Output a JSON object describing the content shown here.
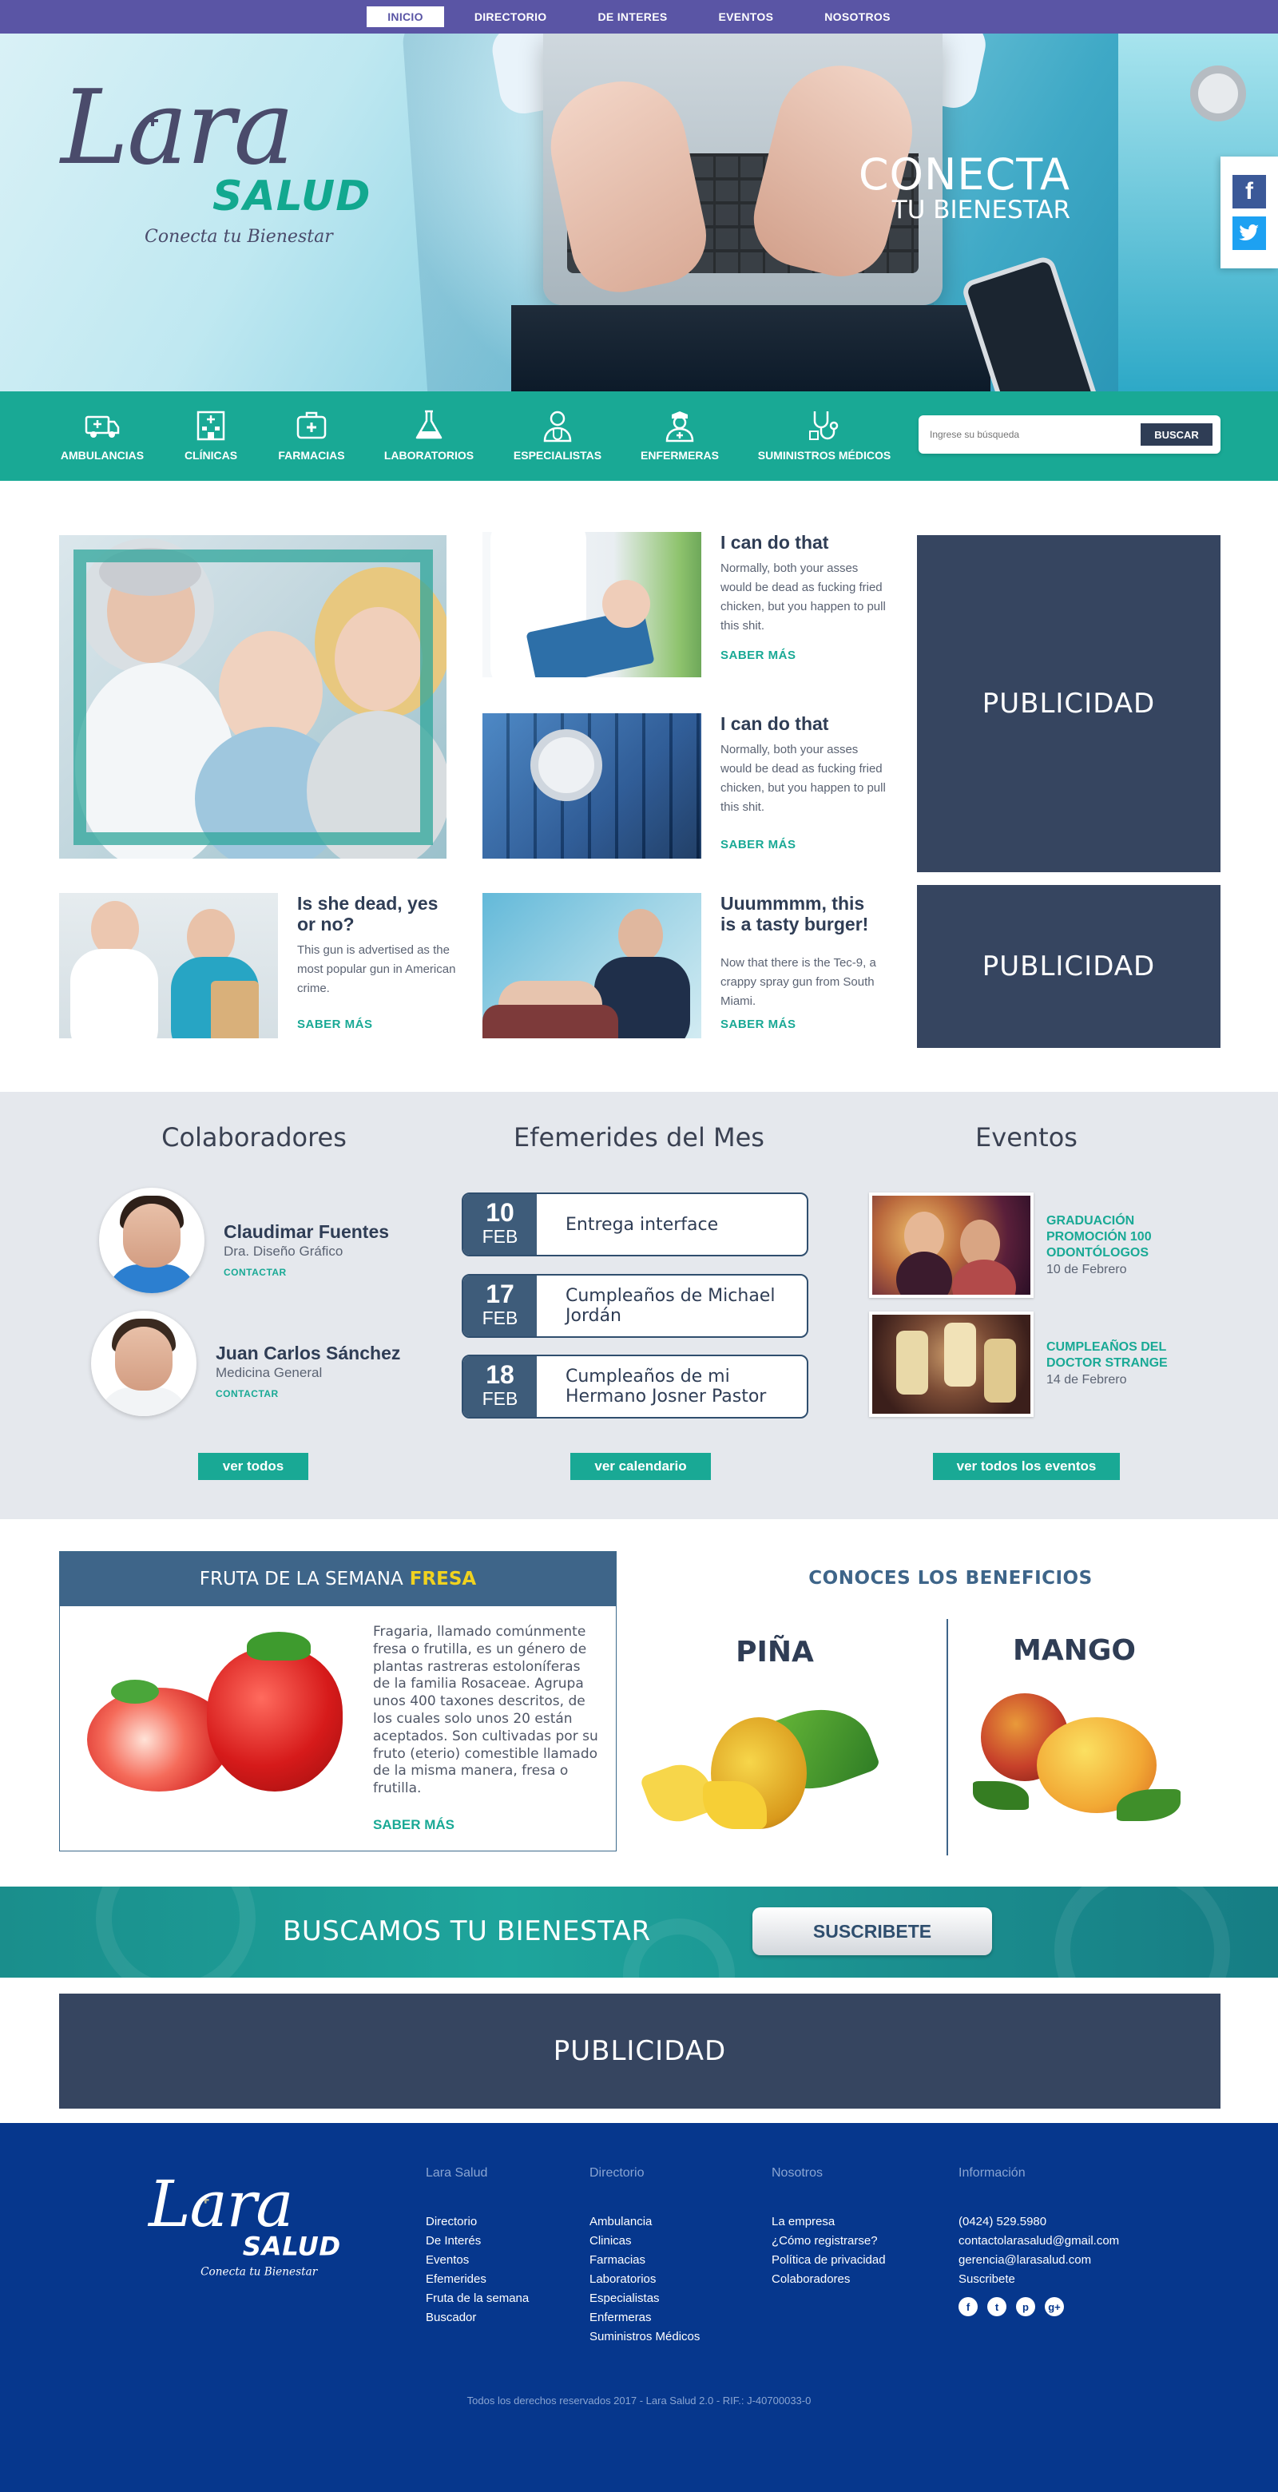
{
  "topnav": {
    "items": [
      "INICIO",
      "DIRECTORIO",
      "DE INTERES",
      "EVENTOS",
      "NOSOTROS"
    ],
    "active": "INICIO"
  },
  "hero": {
    "logo_word": "Lara",
    "logo_salud": "SALUD",
    "logo_tagline": "Conecta tu Bienestar",
    "headline": "CONECTA",
    "subline": "TU BIENESTAR",
    "social": [
      "f",
      "twitter"
    ]
  },
  "categories": {
    "items": [
      {
        "label": "AMBULANCIAS",
        "icon": "ambulance-icon"
      },
      {
        "label": "CLÍNICAS",
        "icon": "clinic-icon"
      },
      {
        "label": "FARMACIAS",
        "icon": "pharmacy-icon"
      },
      {
        "label": "LABORATORIOS",
        "icon": "lab-flask-icon"
      },
      {
        "label": "ESPECIALISTAS",
        "icon": "doctor-icon"
      },
      {
        "label": "ENFERMERAS",
        "icon": "nurse-icon"
      },
      {
        "label": "SUMINISTROS MÉDICOS",
        "icon": "stethoscope-icon"
      }
    ],
    "search_placeholder": "Ingrese su búsqueda",
    "search_button": "BUSCAR"
  },
  "articles": [
    {
      "title": "I can do that",
      "text": "Normally, both your asses would be dead as fucking fried chicken, but you happen to pull this shit.",
      "link": "SABER MÁS"
    },
    {
      "title": "I can do that",
      "text": "Normally, both your asses would be dead as fucking fried chicken, but you happen to pull this shit.",
      "link": "SABER MÁS"
    },
    {
      "title": "Is she dead, yes or no?",
      "text": "This gun is advertised as the most popular gun in American crime.",
      "link": "SABER MÁS"
    },
    {
      "title": "Uuummmm, this is a tasty burger!",
      "text": "Now that there is the Tec-9, a crappy spray gun from South Miami.",
      "link": "SABER MÁS"
    }
  ],
  "ads": {
    "label": "PUBLICIDAD"
  },
  "colaboradores": {
    "title": "Colaboradores",
    "people": [
      {
        "name": "Claudimar Fuentes",
        "role": "Dra. Diseño Gráfico",
        "contact": "CONTACTAR"
      },
      {
        "name": "Juan Carlos Sánchez",
        "role": "Medicina General",
        "contact": "CONTACTAR"
      }
    ],
    "button": "ver todos"
  },
  "efemerides": {
    "title": "Efemerides del Mes",
    "items": [
      {
        "day": "10",
        "month": "FEB",
        "text": "Entrega interface"
      },
      {
        "day": "17",
        "month": "FEB",
        "text": "Cumpleaños de Michael Jordán"
      },
      {
        "day": "18",
        "month": "FEB",
        "text": "Cumpleaños de mi Hermano Josner Pastor"
      }
    ],
    "button": "ver calendario"
  },
  "eventos": {
    "title": "Eventos",
    "items": [
      {
        "title": "GRADUACIÓN PROMOCIÓN 100 ODONTÓLOGOS",
        "date": "10 de Febrero"
      },
      {
        "title": "CUMPLEAÑOS DEL DOCTOR STRANGE",
        "date": "14 de Febrero"
      }
    ],
    "button": "ver todos los eventos"
  },
  "fruta": {
    "heading": "FRUTA DE LA SEMANA",
    "name": "FRESA",
    "text": "Fragaria, llamado comúnmente fresa o frutilla, es un género de plantas rastreras estoloníferas de la familia Rosaceae. Agrupa unos 400 taxones descritos, de los cuales solo unos 20 están aceptados. Son cultivadas por su fruto (eterio) comestible llamado de la misma manera, fresa o frutilla.",
    "link": "SABER MÁS"
  },
  "beneficios": {
    "title": "CONOCES LOS BENEFICIOS",
    "fruits": [
      "PIÑA",
      "MANGO"
    ]
  },
  "subscribe": {
    "text": "BUSCAMOS TU BIENESTAR",
    "button": "SUSCRIBETE"
  },
  "footer": {
    "logo_word": "Lara",
    "logo_salud": "SALUD",
    "logo_tagline": "Conecta tu Bienestar",
    "columns": [
      {
        "heading": "Lara Salud",
        "links": [
          "Directorio",
          "De Interés",
          "Eventos",
          "Efemerides",
          "Fruta de la semana",
          "Buscador"
        ]
      },
      {
        "heading": "Directorio",
        "links": [
          "Ambulancia",
          "Clinicas",
          "Farmacias",
          "Laboratorios",
          "Especialistas",
          "Enfermeras",
          "Suministros Médicos"
        ]
      },
      {
        "heading": "Nosotros",
        "links": [
          "La empresa",
          "¿Cómo registrarse?",
          "Política de privacidad",
          "Colaboradores"
        ]
      },
      {
        "heading": "Información",
        "links": [
          "(0424)  529.5980",
          "contactolarasalud@gmail.com",
          "gerencia@larasalud.com",
          "Suscribete"
        ]
      }
    ],
    "social": [
      "f",
      "t",
      "p",
      "g+"
    ],
    "copyright": "Todos los derechos reservados 2017 - Lara Salud 2.0 - RIF.: J-40700033-0"
  }
}
